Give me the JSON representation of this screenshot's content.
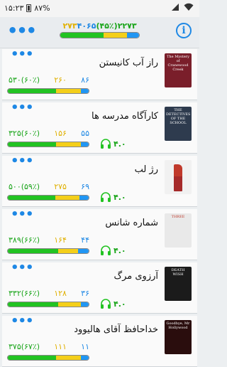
{
  "status_bar": {
    "time": "۱۵:۲۳",
    "battery": "۸۷%",
    "signal_icon": "signal-icon",
    "wifi_icon": "wifi-icon"
  },
  "header": {
    "total": "۲۲۷۳",
    "percent": "(۴۵٪)",
    "read": "۲۷۳",
    "remaining": "۴۰۶۵",
    "progress": {
      "green": 0.55,
      "yellow": 0.3,
      "blue": 0.15
    }
  },
  "colors": {
    "green": "#22c322",
    "yellow": "#f4cf1a",
    "blue": "#2196f3",
    "accent": "#1e88e5"
  },
  "books": [
    {
      "title": "راز آب کانیستن",
      "total": "۵۳۰",
      "percent": "(۶۰٪)",
      "mid": "۲۶۰",
      "small": "۸۶",
      "rating": "",
      "progress": {
        "green": 0.6,
        "yellow": 0.3,
        "blue": 0.1
      },
      "cover_text": "The Mystery of Cranewood Creek",
      "cover_color": "#7a1e2a"
    },
    {
      "title": "کارآگاه مدرسه ها",
      "total": "۳۲۵",
      "percent": "(۶۰٪)",
      "mid": "۱۵۶",
      "small": "۵۵",
      "rating": "۴.۰",
      "progress": {
        "green": 0.6,
        "yellow": 0.3,
        "blue": 0.1
      },
      "cover_text": "THE DETECTIVES OF THE SCHOOL",
      "cover_color": "#2e3b4e"
    },
    {
      "title": "رژ لب",
      "total": "۵۰۰",
      "percent": "(۵۹٪)",
      "mid": "۲۷۵",
      "small": "۶۹",
      "rating": "۴.۰",
      "progress": {
        "green": 0.59,
        "yellow": 0.3,
        "blue": 0.11
      },
      "cover_text": "",
      "cover_color": "#f1f1f1"
    },
    {
      "title": "شماره شانس",
      "total": "۳۸۹",
      "percent": "(۶۶٪)",
      "mid": "۱۶۴",
      "small": "۴۴",
      "rating": "۴.۰",
      "progress": {
        "green": 0.62,
        "yellow": 0.25,
        "blue": 0.13
      },
      "cover_text": "THREE",
      "cover_color": "#e9e9e9"
    },
    {
      "title": "آرزوی مرگ",
      "total": "۳۳۲",
      "percent": "(۶۶٪)",
      "mid": "۱۲۸",
      "small": "۳۶",
      "rating": "۴.۰",
      "progress": {
        "green": 0.62,
        "yellow": 0.28,
        "blue": 0.1
      },
      "cover_text": "DEATH WISH",
      "cover_color": "#1b1b1b"
    },
    {
      "title": "خداحافظ آقای هالیوود",
      "total": "۳۷۵",
      "percent": "(۶۷٪)",
      "mid": "۱۱۱",
      "small": "۱۱",
      "rating": "",
      "progress": {
        "green": 0.6,
        "yellow": 0.3,
        "blue": 0.1
      },
      "cover_text": "Goodbye, Mr Hollywood",
      "cover_color": "#2a0d0d"
    }
  ]
}
